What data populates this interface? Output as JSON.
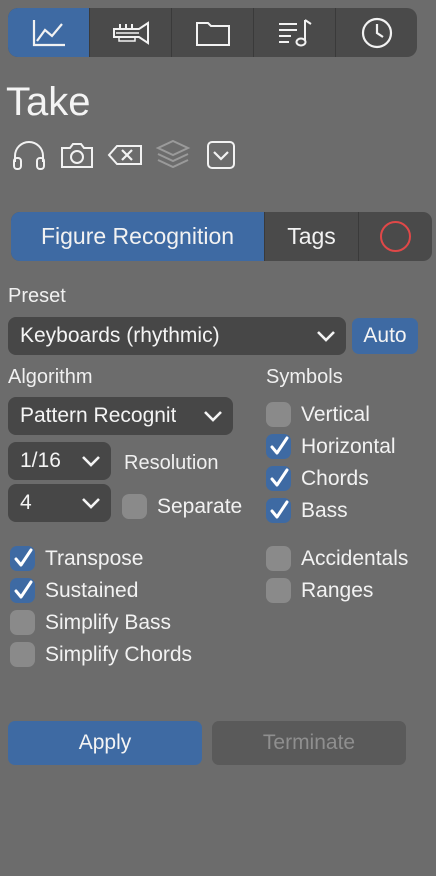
{
  "toolbar": {
    "items": [
      {
        "icon": "chart-line-icon",
        "active": true
      },
      {
        "icon": "trumpet-icon",
        "active": false
      },
      {
        "icon": "folder-icon",
        "active": false
      },
      {
        "icon": "playlist-music-icon",
        "active": false
      },
      {
        "icon": "clock-icon",
        "active": false
      }
    ]
  },
  "title": "Take",
  "action_icons": [
    "headphones-icon",
    "camera-icon",
    "delete-backspace-icon",
    "layers-icon",
    "dropdown-box-icon"
  ],
  "tabs": {
    "figure_recognition": "Figure Recognition",
    "tags": "Tags"
  },
  "preset": {
    "label": "Preset",
    "value": "Keyboards (rhythmic)",
    "auto_label": "Auto"
  },
  "algorithm": {
    "label": "Algorithm",
    "value": "Pattern Recognit",
    "resolution_value": "1/16",
    "resolution_label": "Resolution",
    "count_value": "4",
    "separate_label": "Separate",
    "separate_checked": false
  },
  "symbols": {
    "label": "Symbols",
    "items": [
      {
        "label": "Vertical",
        "checked": false
      },
      {
        "label": "Horizontal",
        "checked": true
      },
      {
        "label": "Chords",
        "checked": true
      },
      {
        "label": "Bass",
        "checked": true
      }
    ],
    "accidentals": {
      "label": "Accidentals",
      "checked": false
    },
    "ranges": {
      "label": "Ranges",
      "checked": false
    }
  },
  "options": [
    {
      "label": "Transpose",
      "checked": true
    },
    {
      "label": "Sustained",
      "checked": true
    },
    {
      "label": "Simplify Bass",
      "checked": false
    },
    {
      "label": "Simplify Chords",
      "checked": false
    }
  ],
  "footer": {
    "apply_label": "Apply",
    "terminate_label": "Terminate"
  },
  "colors": {
    "accent": "#3e6aa3",
    "background": "#6c6c6c",
    "record": "#e04848"
  }
}
